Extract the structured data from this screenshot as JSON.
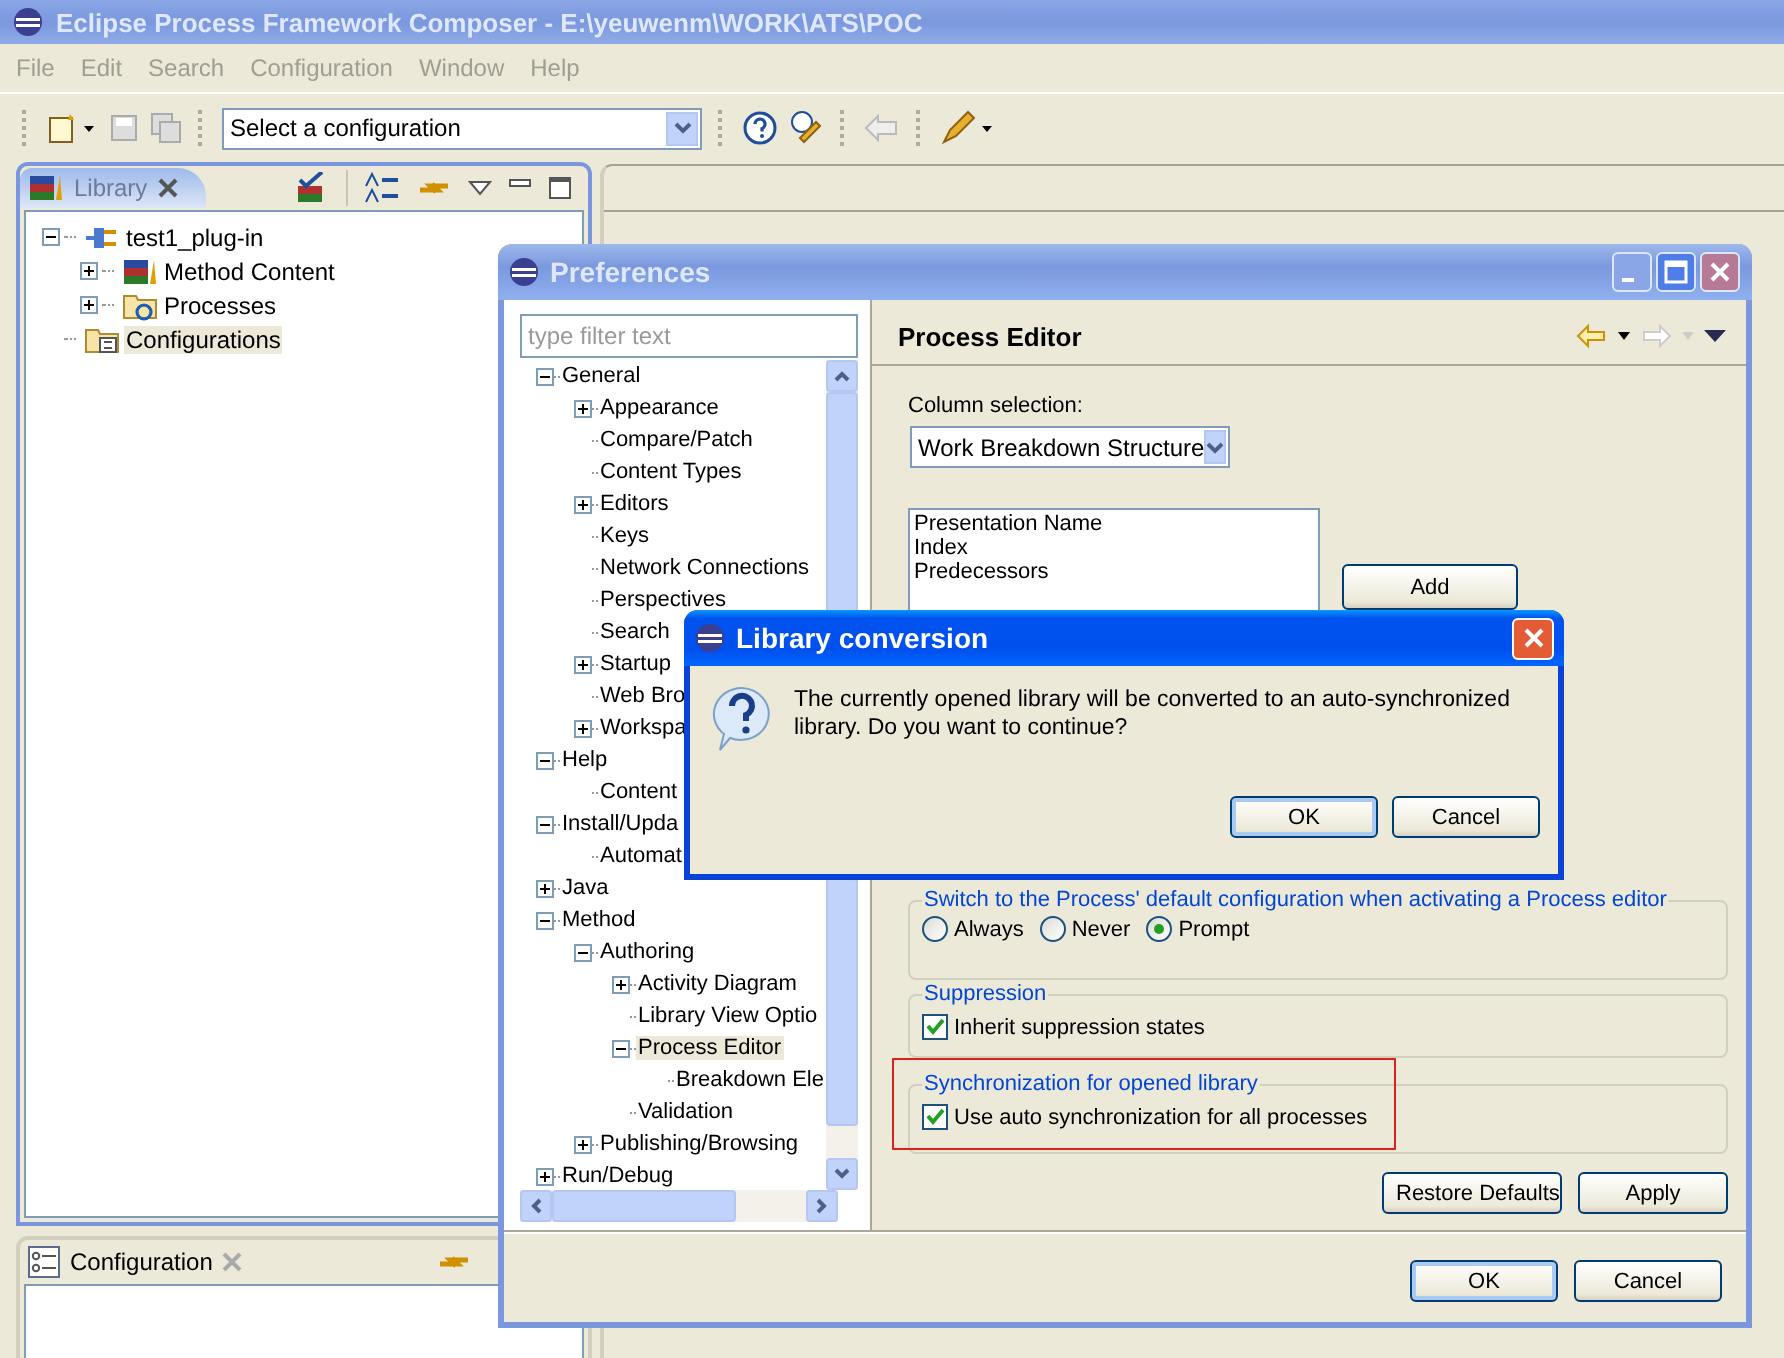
{
  "main_window": {
    "title": "Eclipse Process Framework Composer - E:\\yeuwenm\\WORK\\ATS\\POC",
    "menu": [
      "File",
      "Edit",
      "Search",
      "Configuration",
      "Window",
      "Help"
    ],
    "configuration_select": "Select a configuration",
    "library_view": {
      "tab": "Library",
      "tree": [
        {
          "label": "test1_plug-in",
          "kind": "plugin",
          "expanded": true,
          "selected": false,
          "children": [
            {
              "label": "Method Content",
              "kind": "content",
              "expanded": false,
              "selected": false
            },
            {
              "label": "Processes",
              "kind": "processes",
              "expanded": false,
              "selected": false
            }
          ]
        },
        {
          "label": "Configurations",
          "kind": "configurations",
          "selected": true
        }
      ]
    },
    "configuration_view": {
      "tab": "Configuration"
    }
  },
  "preferences": {
    "title": "Preferences",
    "filter_placeholder": "type filter text",
    "tree": [
      {
        "label": "General",
        "expanded": true,
        "selected": false,
        "children": [
          {
            "label": "Appearance",
            "expanded": false,
            "selected": false
          },
          {
            "label": "Compare/Patch",
            "selected": false
          },
          {
            "label": "Content Types",
            "selected": false
          },
          {
            "label": "Editors",
            "expanded": false,
            "selected": false
          },
          {
            "label": "Keys",
            "selected": false
          },
          {
            "label": "Network Connections",
            "selected": false
          },
          {
            "label": "Perspectives",
            "selected": false
          },
          {
            "label": "Search",
            "selected": false
          },
          {
            "label": "Startup",
            "expanded": false,
            "selected": false
          },
          {
            "label": "Web Bro",
            "selected": false
          },
          {
            "label": "Workspa",
            "expanded": false,
            "selected": false
          }
        ]
      },
      {
        "label": "Help",
        "expanded": true,
        "selected": false,
        "children": [
          {
            "label": "Content",
            "selected": false
          }
        ]
      },
      {
        "label": "Install/Upda",
        "expanded": true,
        "selected": false,
        "children": [
          {
            "label": "Automat",
            "selected": false
          }
        ]
      },
      {
        "label": "Java",
        "expanded": false,
        "selected": false
      },
      {
        "label": "Method",
        "expanded": true,
        "selected": false,
        "children": [
          {
            "label": "Authoring",
            "expanded": true,
            "selected": false,
            "children": [
              {
                "label": "Activity Diagram",
                "expanded": false,
                "selected": false
              },
              {
                "label": "Library View Optio",
                "selected": false
              },
              {
                "label": "Process Editor",
                "expanded": true,
                "selected": true,
                "children": [
                  {
                    "label": "Breakdown Ele",
                    "selected": false
                  }
                ]
              },
              {
                "label": "Validation",
                "selected": false
              }
            ]
          },
          {
            "label": "Publishing/Browsing",
            "expanded": false,
            "selected": false
          }
        ]
      },
      {
        "label": "Run/Debug",
        "expanded": false,
        "selected": false
      }
    ],
    "page": {
      "title": "Process Editor",
      "column_selection_label": "Column selection:",
      "column_selection": "Work Breakdown Structure",
      "columns": [
        "Presentation Name",
        "Index",
        "Predecessors"
      ],
      "add_button": "Add",
      "switch_group": {
        "title": "Switch to the Process' default configuration when activating a Process editor",
        "options": [
          {
            "label": "Always",
            "selected": false
          },
          {
            "label": "Never",
            "selected": false
          },
          {
            "label": "Prompt",
            "selected": true
          }
        ]
      },
      "suppression_group": {
        "title": "Suppression",
        "checkbox": {
          "label": "Inherit suppression states",
          "checked": true
        }
      },
      "sync_group": {
        "title": "Synchronization for opened library",
        "checkbox": {
          "label": "Use auto synchronization for all processes",
          "checked": true
        }
      },
      "buttons": [
        "Restore Defaults",
        "Apply"
      ]
    },
    "buttons": [
      "OK",
      "Cancel"
    ]
  },
  "dialog": {
    "title": "Library conversion",
    "message": "The currently opened library will be converted to an auto-synchronized library. Do you want to continue?",
    "buttons": [
      "OK",
      "Cancel"
    ]
  }
}
